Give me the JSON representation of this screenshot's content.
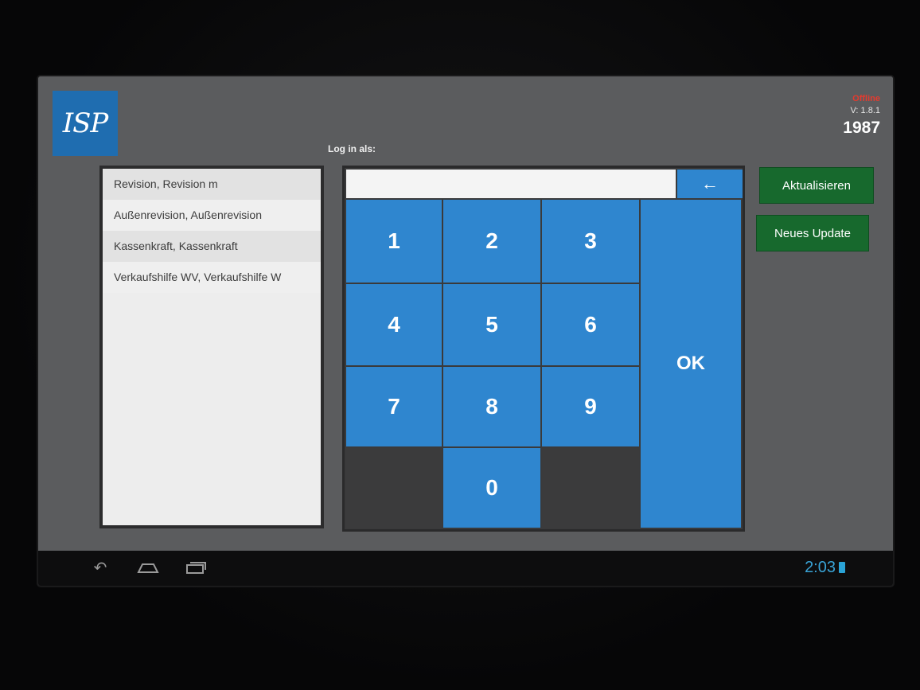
{
  "header": {
    "logo_text": "ISP",
    "status_offline": "Offline",
    "version": "V: 1.8.1",
    "store_number": "1987",
    "login_label": "Log in als:"
  },
  "users": [
    {
      "name": "Revision, Revision m"
    },
    {
      "name": "Außenrevision, Außenrevision"
    },
    {
      "name": "Kassenkraft, Kassenkraft"
    },
    {
      "name": "Verkaufshilfe WV, Verkaufshilfe W"
    }
  ],
  "keypad": {
    "pin_value": "",
    "backspace_icon": "arrow-left-icon",
    "keys": {
      "k1": "1",
      "k2": "2",
      "k3": "3",
      "k4": "4",
      "k5": "5",
      "k6": "6",
      "k7": "7",
      "k8": "8",
      "k9": "9",
      "k0": "0"
    },
    "ok_label": "OK"
  },
  "actions": {
    "refresh_label": "Aktualisieren",
    "update_label": "Neues Update"
  },
  "navbar": {
    "back_icon": "back-icon",
    "home_icon": "home-icon",
    "recents_icon": "recents-icon",
    "time": "2:03"
  },
  "colors": {
    "key_blue": "#2f86cf",
    "button_green": "#17692d",
    "offline_red": "#e53a2e",
    "clock_blue": "#39a3d6"
  }
}
